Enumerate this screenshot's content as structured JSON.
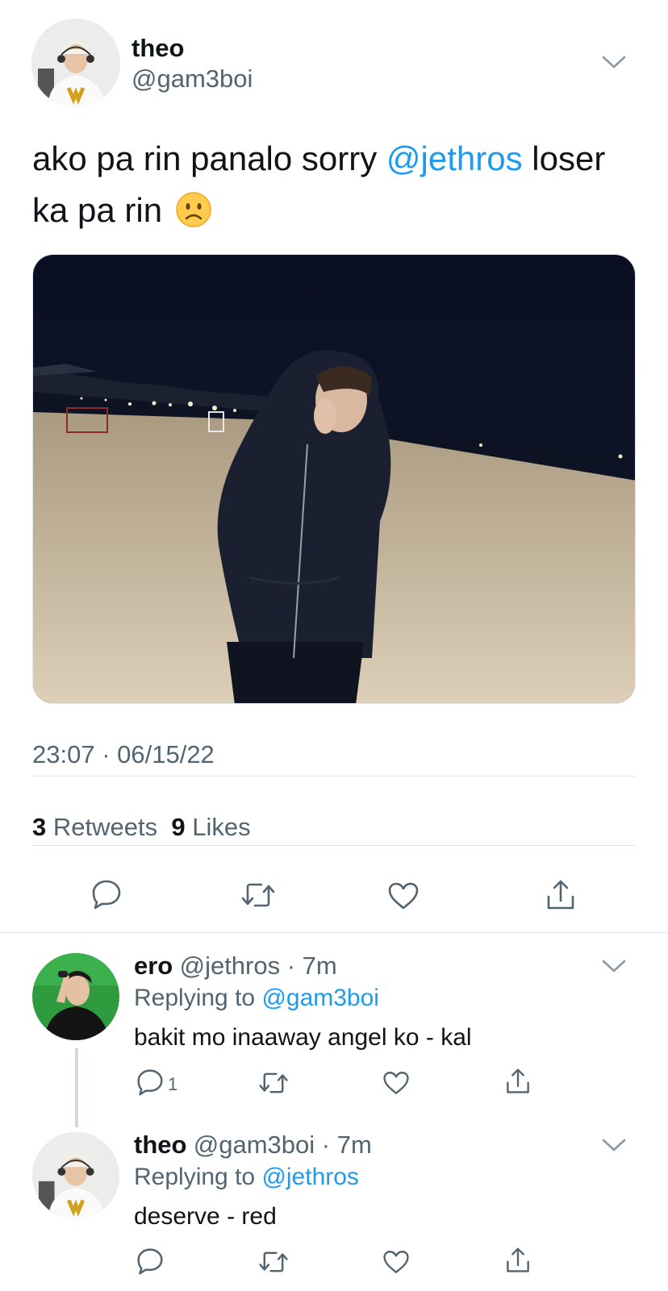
{
  "tweet": {
    "author_name": "theo",
    "author_handle": "@gam3boi",
    "text_before": "ako pa rin panalo sorry ",
    "mention": "@jethros",
    "text_after": " loser ka pa rin",
    "emoji": "slightly-frowning-face",
    "timestamp": "23:07 · 06/15/22",
    "retweets_count": "3",
    "retweets_label": "Retweets",
    "likes_count": "9",
    "likes_label": "Likes",
    "actions": [
      "reply-icon",
      "retweet-icon",
      "like-icon",
      "share-icon"
    ]
  },
  "replies": [
    {
      "name": "ero",
      "handle": "@jethros",
      "time": "7m",
      "replying_label": "Replying to",
      "replying_to": "@gam3boi",
      "text": "bakit mo inaaway angel ko - kal",
      "reply_count": "1"
    },
    {
      "name": "theo",
      "handle": "@gam3boi",
      "time": "7m",
      "replying_label": "Replying to",
      "replying_to": "@jethros",
      "text": "deserve - red"
    }
  ],
  "colors": {
    "accent": "#1d9bf0",
    "secondary_text": "#536471",
    "primary_text": "#0f1419"
  }
}
